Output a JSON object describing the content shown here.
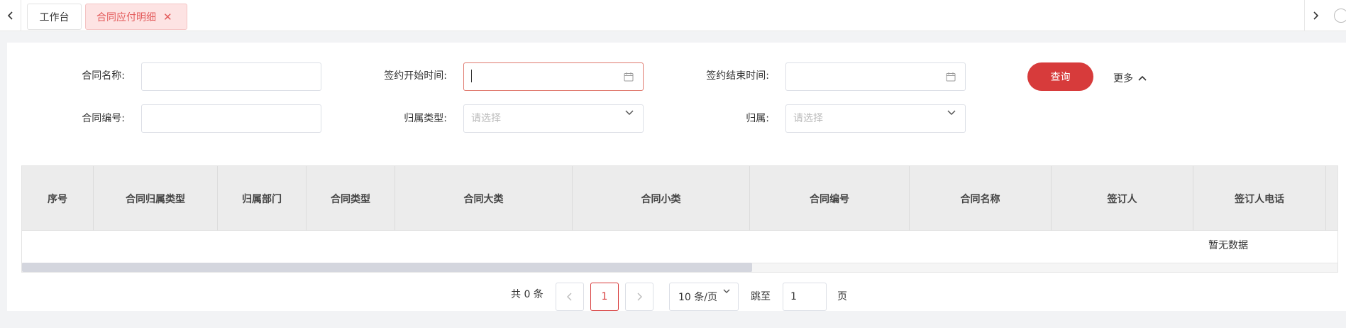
{
  "tabs": {
    "items": [
      {
        "label": "工作台"
      },
      {
        "label": "合同应付明细",
        "active": true,
        "close": "✕"
      }
    ]
  },
  "form": {
    "contract_name": {
      "label": "合同名称:",
      "value": "",
      "placeholder": ""
    },
    "sign_start": {
      "label": "签约开始时间:",
      "value": "",
      "placeholder": ""
    },
    "sign_end": {
      "label": "签约结束时间:",
      "value": "",
      "placeholder": ""
    },
    "contract_no": {
      "label": "合同编号:",
      "value": "",
      "placeholder": ""
    },
    "belong_type": {
      "label": "归属类型:",
      "placeholder": "请选择"
    },
    "belong": {
      "label": "归属:",
      "placeholder": "请选择"
    },
    "query_label": "查询",
    "more_label": "更多"
  },
  "table": {
    "columns": [
      "序号",
      "合同归属类型",
      "归属部门",
      "合同类型",
      "合同大类",
      "合同小类",
      "合同编号",
      "合同名称",
      "签订人",
      "签订人电话"
    ],
    "rows": [],
    "empty_text": "暂无数据"
  },
  "pagination": {
    "total_label": "共 0 条",
    "current_page": "1",
    "page_size_label": "10 条/页",
    "goto_label": "跳至",
    "goto_value": "1",
    "page_unit": "页"
  },
  "colors": {
    "accent": "#d73b3b",
    "active_tab_bg": "#fde3e3",
    "active_tab_text": "#e35a5a"
  }
}
